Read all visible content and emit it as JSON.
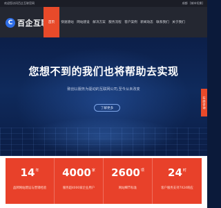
{
  "topbar": {
    "left": "欢迎您访问百企互联官网",
    "right_1": "成都",
    "right_2": "[城市切换]"
  },
  "logo": {
    "mark": "C",
    "text": "百企互联"
  },
  "menu": [
    {
      "label": "首页",
      "active": true
    },
    {
      "label": "快速建站"
    },
    {
      "label": "网站建设"
    },
    {
      "label": "解决方案"
    },
    {
      "label": "服务流程"
    },
    {
      "label": "客户案例"
    },
    {
      "label": "新闻动态"
    },
    {
      "label": "联系我们"
    },
    {
      "label": "关于我们"
    }
  ],
  "hero": {
    "headline": "您想不到的我们也将帮助去实现",
    "subline": "致创以服务为驱动的互联网公司,至今从未改变",
    "cta": "了解更多"
  },
  "side_float": "在线咨询",
  "stats": [
    {
      "num": "14",
      "unit": "年",
      "label": "品牌网站建设与营销经验"
    },
    {
      "num": "4000",
      "unit": "家",
      "label": "服务超4000家企业用户"
    },
    {
      "num": "2600",
      "unit": "项",
      "label": "网站细节标准"
    },
    {
      "num": "24",
      "unit": "时",
      "label": "客户服务支持7X24响应"
    }
  ],
  "colors": {
    "accent": "#e8412a",
    "nav_bg": "#242731",
    "hero_bg": "#0c1f49"
  }
}
